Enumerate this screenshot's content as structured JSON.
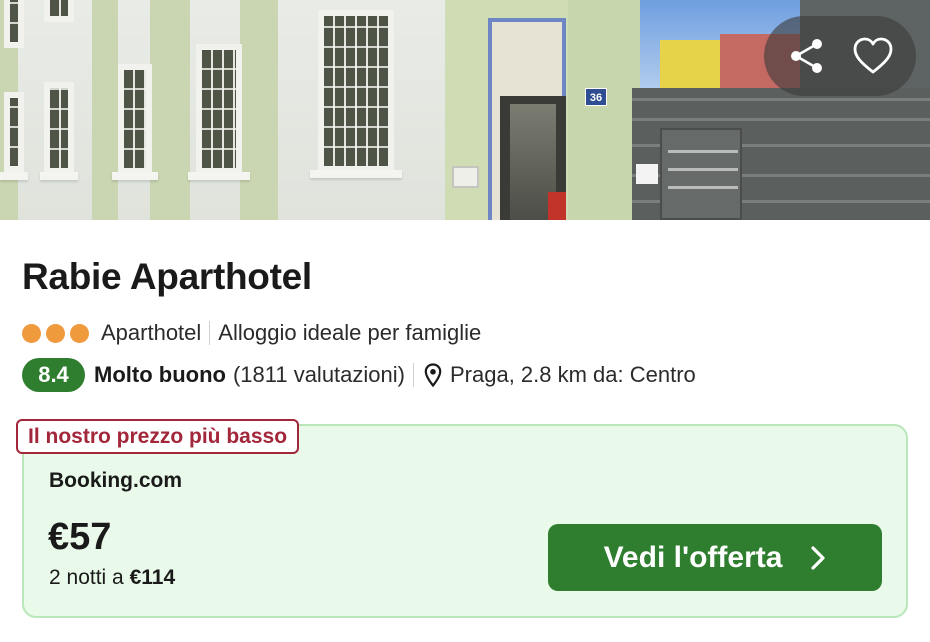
{
  "listing": {
    "name": "Rabie Aparthotel",
    "star_count": 3,
    "type": "Aparthotel",
    "highlight": "Alloggio ideale per famiglie",
    "rating": {
      "score": "8.4",
      "label": "Molto buono",
      "reviews": "(1811 valutazioni)"
    },
    "location": "Praga, 2.8 km da: Centro",
    "photo": {
      "house_number": "36"
    }
  },
  "actions": {
    "share_icon": "share-icon",
    "favorite_icon": "heart-icon"
  },
  "offer": {
    "badge": "Il nostro prezzo più basso",
    "provider": "Booking.com",
    "price": "€57",
    "nights_text": "2 notti a ",
    "nights_total": "€114",
    "cta_label": "Vedi l'offerta"
  },
  "colors": {
    "rating_green": "#2f7d2f",
    "cta_green": "#2f7d2f",
    "star_dot_orange": "#f09a3e",
    "badge_red": "#a3273a",
    "card_background": "#eafaea"
  }
}
